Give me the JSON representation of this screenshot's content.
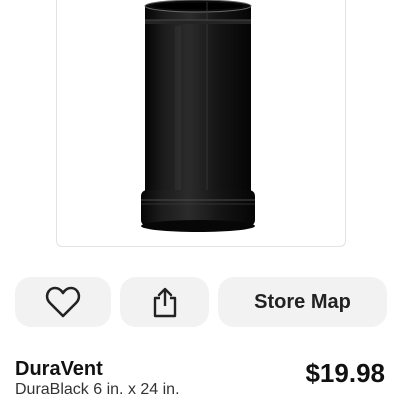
{
  "product": {
    "image_alt": "black chimney pipe",
    "brand": "DuraVent",
    "description": "DuraBlack 6 in. x 24 in.",
    "price": "$19.98"
  },
  "actions": {
    "favorite_icon": "heart-icon",
    "share_icon": "share-icon",
    "store_map_label": "Store Map"
  },
  "colors": {
    "button_bg": "#f2f2f2",
    "text_primary": "#111111",
    "pipe": "#151515"
  }
}
